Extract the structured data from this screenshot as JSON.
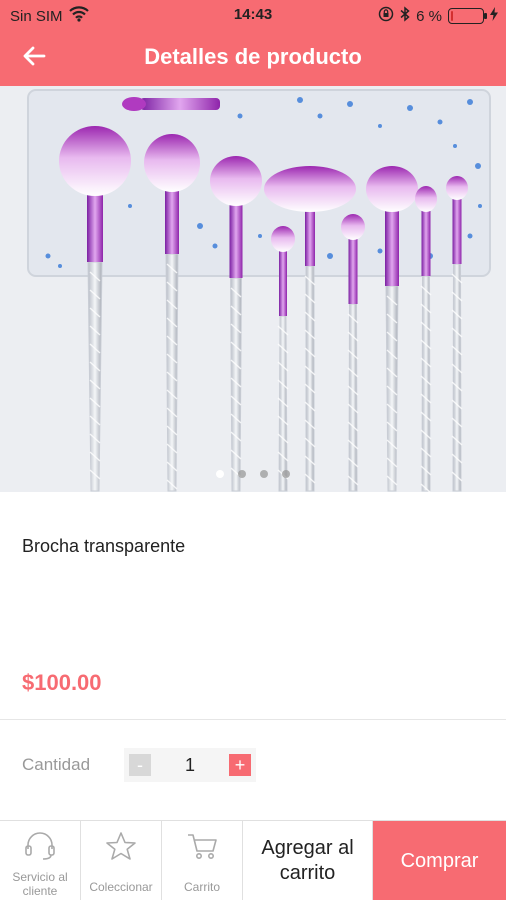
{
  "status_bar": {
    "carrier": "Sin SIM",
    "time": "14:43",
    "battery_percent": "6 %",
    "battery_level": 0.06,
    "icons": [
      "wifi-icon",
      "orientation-lock-icon",
      "bluetooth-icon",
      "battery-icon",
      "charging-icon"
    ]
  },
  "header": {
    "title": "Detalles de producto",
    "back_icon": "arrow-left-icon",
    "background": "#f76b72"
  },
  "carousel": {
    "page_count": 4,
    "active_index": 0
  },
  "product": {
    "name": "Brocha transparente",
    "price": "$100.00",
    "price_color": "#f76b72"
  },
  "quantity": {
    "label": "Cantidad",
    "value": "1",
    "minus": "-",
    "plus": "+"
  },
  "bottom_bar": {
    "service_label": "Servicio al cliente",
    "service_icon": "headset-icon",
    "collect_label": "Coleccionar",
    "collect_icon": "star-icon",
    "cart_label": "Carrito",
    "cart_icon": "cart-icon",
    "add_to_cart": "Agregar al carrito",
    "buy": "Comprar"
  }
}
